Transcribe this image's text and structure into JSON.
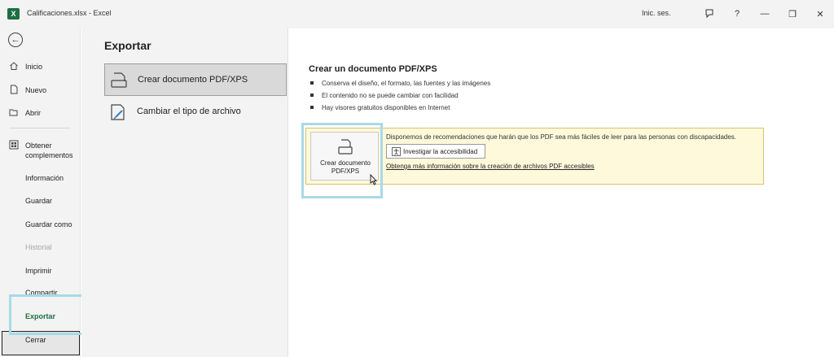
{
  "titlebar": {
    "app_logo": "X",
    "title": "Calificaciones.xlsx  -  Excel",
    "signin": "Inic. ses.",
    "icons": [
      "feedback-icon",
      "help-icon",
      "minimize-icon",
      "restore-icon",
      "close-icon"
    ],
    "help_glyph": "?",
    "minimize_glyph": "—",
    "restore_glyph": "❐",
    "close_glyph": "✕"
  },
  "nav": {
    "back_glyph": "←",
    "items": [
      {
        "label": "Inicio",
        "icon": "home-icon"
      },
      {
        "label": "Nuevo",
        "icon": "new-document-icon"
      },
      {
        "label": "Abrir",
        "icon": "folder-open-icon"
      },
      {
        "label": "Obtener complementos",
        "icon": "add-ins-icon"
      },
      {
        "label": "Información"
      },
      {
        "label": "Guardar"
      },
      {
        "label": "Guardar como"
      },
      {
        "label": "Historial",
        "disabled": true
      },
      {
        "label": "Imprimir"
      },
      {
        "label": "Compartir"
      },
      {
        "label": "Exportar",
        "selected": true
      },
      {
        "label": "Cerrar"
      }
    ]
  },
  "middle": {
    "title": "Exportar",
    "options": [
      {
        "label": "Crear documento PDF/XPS",
        "icon": "pdf-document-icon",
        "selected": true
      },
      {
        "label": "Cambiar el tipo de archivo",
        "icon": "change-file-type-icon"
      }
    ]
  },
  "content": {
    "title": "Crear un documento PDF/XPS",
    "bullets": [
      "Conserva el diseño, el formato, las fuentes y las imágenes",
      "El contenido no se puede cambiar con facilidad",
      "Hay visores gratuitos disponibles en Internet"
    ],
    "create_button": {
      "line1": "Crear documento",
      "line2": "PDF/XPS",
      "icon": "pdf-document-icon"
    },
    "notice_text": "Disponemos de recomendaciones que harán que los PDF sea más fáciles de leer para las personas con discapacidades.",
    "accessibility_button": "Investigar la accesibilidad",
    "more_link": "Obtenga más información sobre la creación de archivos PDF accesibles"
  },
  "colors": {
    "excel_green": "#1d6f42",
    "highlight": "#a9d9e7",
    "notice_bg": "#fff9db",
    "selected_nav_text": "#1d6f42"
  }
}
